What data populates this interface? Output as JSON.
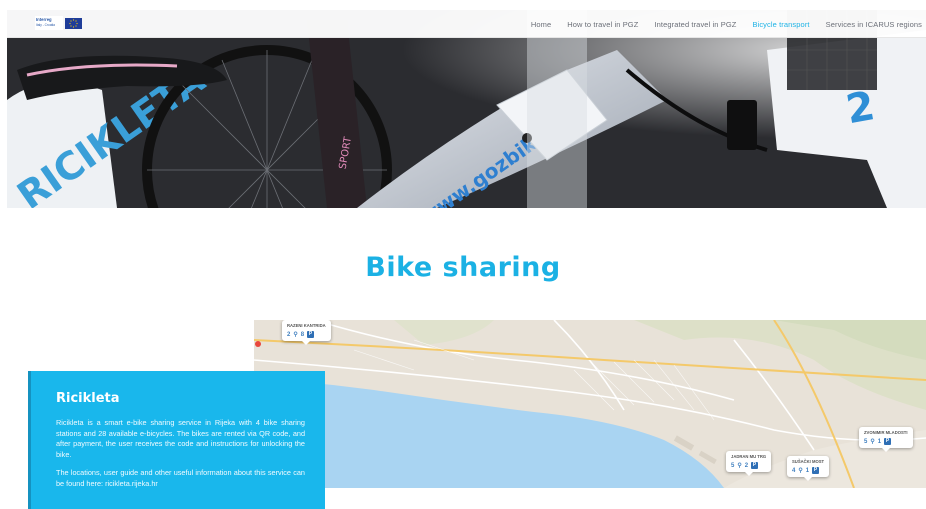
{
  "header": {
    "logo_alt": "Interreg Italy - Croatia",
    "nav": [
      {
        "label": "Home",
        "active": false
      },
      {
        "label": "How to travel in PGZ",
        "active": false
      },
      {
        "label": "Integrated travel in PGZ",
        "active": false
      },
      {
        "label": "Bicycle transport",
        "active": true
      },
      {
        "label": "Services in ICARUS regions",
        "active": false
      }
    ]
  },
  "hero": {
    "bike_brand": "RICIKLETA",
    "frame_text": "www.gozbike",
    "dock_number": "2"
  },
  "page_title": "Bike sharing",
  "map": {
    "stations": [
      {
        "name": "RAZENI KANTRIDA",
        "bikes": "2",
        "docks": "8"
      },
      {
        "name": "JADRAN MU TRG",
        "bikes": "5",
        "docks": "2"
      },
      {
        "name": "SUŠAČKI MOST",
        "bikes": "4",
        "docks": "1"
      },
      {
        "name": "ZVONIMIR MLADOSTI",
        "bikes": "5",
        "docks": "1"
      }
    ]
  },
  "card": {
    "title": "Ricikleta",
    "paragraph1": "Ricikleta is a smart e-bike sharing service in Rijeka with 4 bike sharing stations and 28 available e-bicycles. The bikes are rented via QR code, and after payment, the user receives the code and instructions for unlocking the bike.",
    "paragraph2": "The locations, user guide and other useful information about this service can be found here: ricikleta.rijeka.hr"
  },
  "colors": {
    "accent": "#1bb1e4",
    "card_bg": "#19b7ec",
    "nav_active": "#1eb3e6",
    "nav_text": "#6b6f78"
  }
}
